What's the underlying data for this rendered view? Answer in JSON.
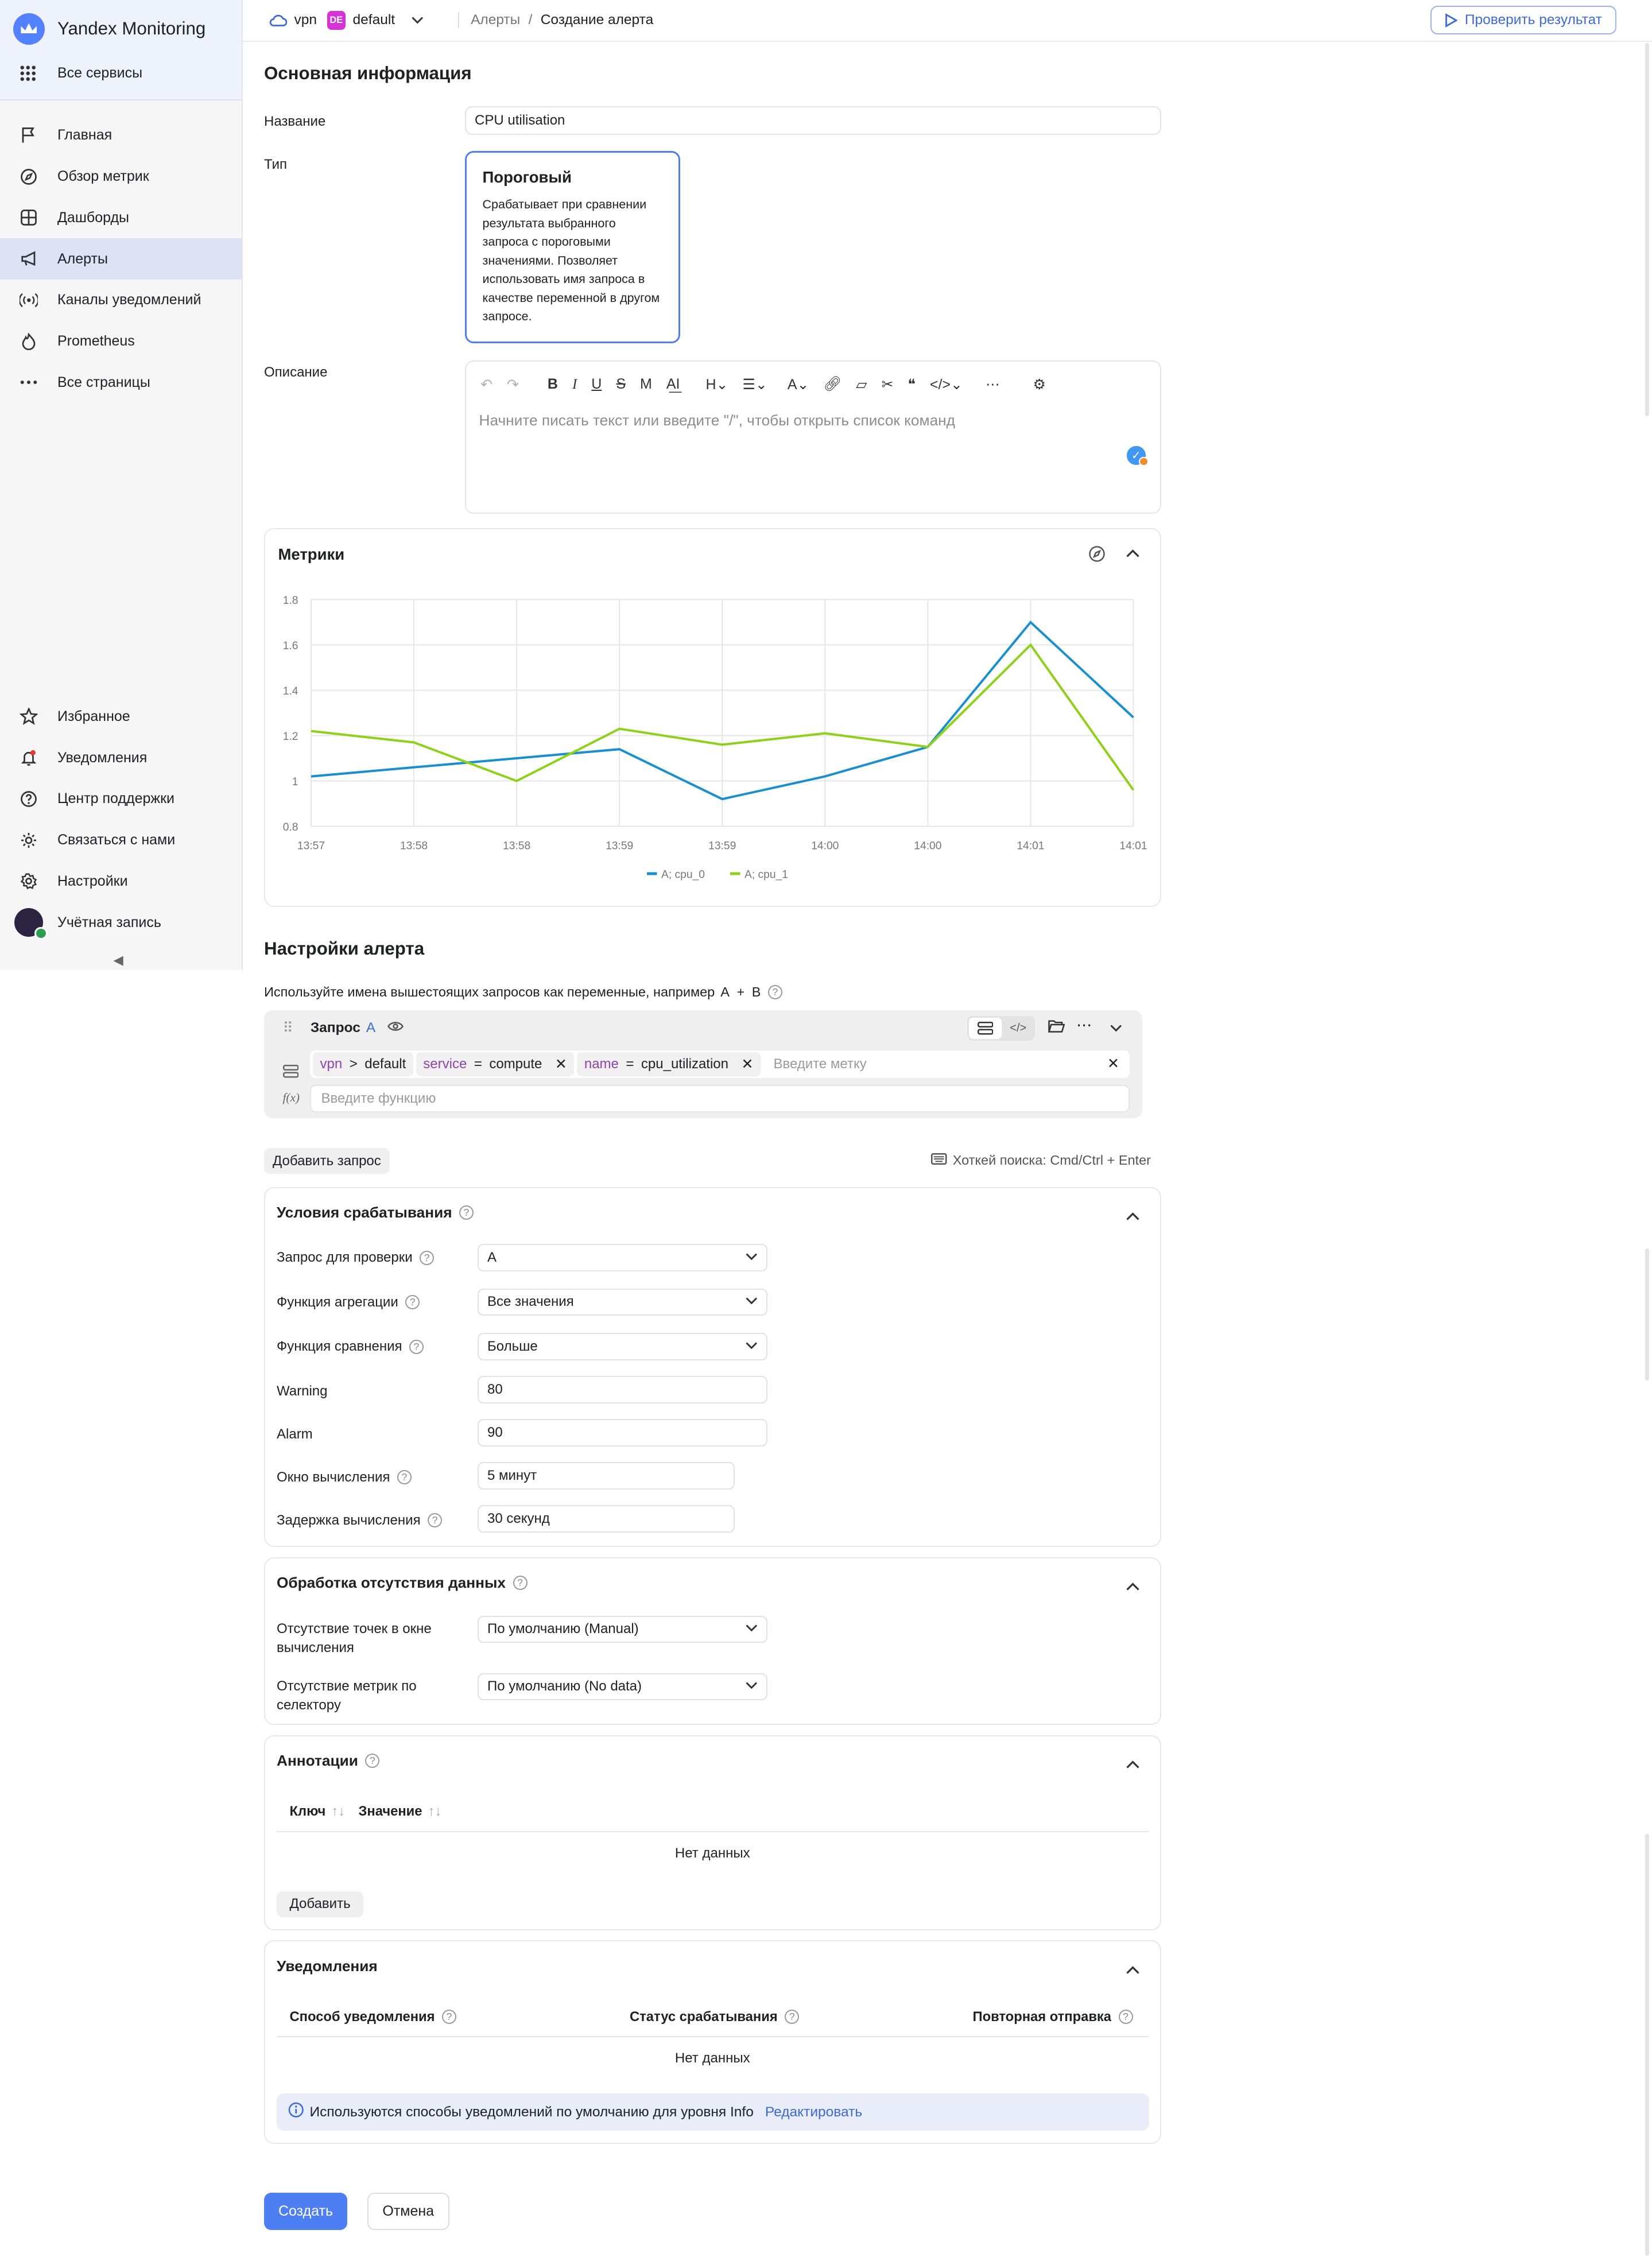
{
  "app": {
    "title": "Yandex Monitoring",
    "all_services": "Все сервисы"
  },
  "nav": [
    {
      "label": "Главная",
      "icon": "flag-icon"
    },
    {
      "label": "Обзор метрик",
      "icon": "compass-icon"
    },
    {
      "label": "Дашборды",
      "icon": "grid-icon"
    },
    {
      "label": "Алерты",
      "icon": "megaphone-icon",
      "active": true
    },
    {
      "label": "Каналы уведомлений",
      "icon": "broadcast-icon"
    },
    {
      "label": "Prometheus",
      "icon": "flame-icon"
    },
    {
      "label": "Все страницы",
      "icon": "ellipsis-icon"
    }
  ],
  "nav_bottom": [
    {
      "label": "Избранное",
      "icon": "star-icon"
    },
    {
      "label": "Уведомления",
      "icon": "bell-icon"
    },
    {
      "label": "Центр поддержки",
      "icon": "help-circle-icon"
    },
    {
      "label": "Связаться с нами",
      "icon": "chat-gear-icon"
    },
    {
      "label": "Настройки",
      "icon": "gear-icon"
    },
    {
      "label": "Учётная запись",
      "icon": "avatar"
    }
  ],
  "topbar": {
    "project": "vpn",
    "badge": "DE",
    "folder": "default",
    "crumb_parent": "Алерты",
    "crumb_sep": "/",
    "crumb_current": "Создание алерта",
    "check_button": "Проверить результат"
  },
  "basic": {
    "title": "Основная информация",
    "name_label": "Название",
    "name_value": "CPU utilisation",
    "type_label": "Тип",
    "type_title": "Пороговый",
    "type_desc": "Срабатывает при сравнении результата выбранного запроса с пороговыми значениями. Позволяет использовать имя запроса в качестве переменной в другом запросе.",
    "desc_label": "Описание",
    "desc_placeholder": "Начните писать текст или введите \"/\", чтобы открыть список команд"
  },
  "chart_data": {
    "type": "line",
    "title": "Метрики",
    "x": [
      "13:57",
      "13:58",
      "13:58",
      "13:59",
      "13:59",
      "14:00",
      "14:00",
      "14:01",
      "14:01"
    ],
    "series": [
      {
        "name": "A; cpu_0",
        "color": "#1a8fd0",
        "values": [
          1.02,
          1.06,
          1.1,
          1.14,
          0.92,
          1.02,
          1.15,
          1.7,
          1.28
        ]
      },
      {
        "name": "A; cpu_1",
        "color": "#8fd11a",
        "values": [
          1.22,
          1.17,
          1.0,
          1.23,
          1.16,
          1.21,
          1.15,
          1.6,
          0.96
        ]
      }
    ],
    "yticks": [
      "0.8",
      "1",
      "1.2",
      "1.4",
      "1.6",
      "1.8"
    ],
    "ylim": [
      0.8,
      1.8
    ],
    "grid": true,
    "legend": "bottom-center"
  },
  "alert": {
    "title": "Настройки алерта",
    "hint": "Используйте имена вышестоящих запросов как переменные, например",
    "hint_a": "A",
    "hint_plus": "+",
    "hint_b": "B",
    "query_title": "Запрос",
    "query_letter": "A",
    "sel_project": "vpn",
    "sel_gt": ">",
    "sel_folder": "default",
    "tag1_key": "service",
    "tag1_op": "=",
    "tag1_val": "compute",
    "tag2_key": "name",
    "tag2_op": "=",
    "tag2_val": "cpu_utilization",
    "label_placeholder": "Введите метку",
    "func_placeholder": "Введите функцию",
    "add_query": "Добавить запрос",
    "hotkey": "Хоткей поиска: Cmd/Ctrl + Enter"
  },
  "conditions": {
    "title": "Условия срабатывания",
    "rows": [
      {
        "label": "Запрос для проверки",
        "value": "A"
      },
      {
        "label": "Функция агрегации",
        "value": "Все значения"
      },
      {
        "label": "Функция сравнения",
        "value": "Больше"
      },
      {
        "label": "Warning",
        "value": "80"
      },
      {
        "label": "Alarm",
        "value": "90"
      },
      {
        "label": "Окно вычисления",
        "value": "5 минут"
      },
      {
        "label": "Задержка вычисления",
        "value": "30 секунд"
      }
    ]
  },
  "nodata": {
    "title": "Обработка отсутствия данных",
    "row1_label": "Отсутствие точек в окне вычисления",
    "row1_value": "По умолчанию (Manual)",
    "row2_label": "Отсутствие метрик по селектору",
    "row2_value": "По умолчанию (No data)"
  },
  "annotations": {
    "title": "Аннотации",
    "col_key": "Ключ",
    "col_value": "Значение",
    "empty": "Нет данных",
    "add": "Добавить"
  },
  "notifications": {
    "title": "Уведомления",
    "col1": "Способ уведомления",
    "col2": "Статус срабатывания",
    "col3": "Повторная отправка",
    "empty": "Нет данных",
    "info": "Используются способы уведомлений по умолчанию для уровня Info",
    "edit": "Редактировать"
  },
  "actions": {
    "create": "Создать",
    "cancel": "Отмена"
  }
}
